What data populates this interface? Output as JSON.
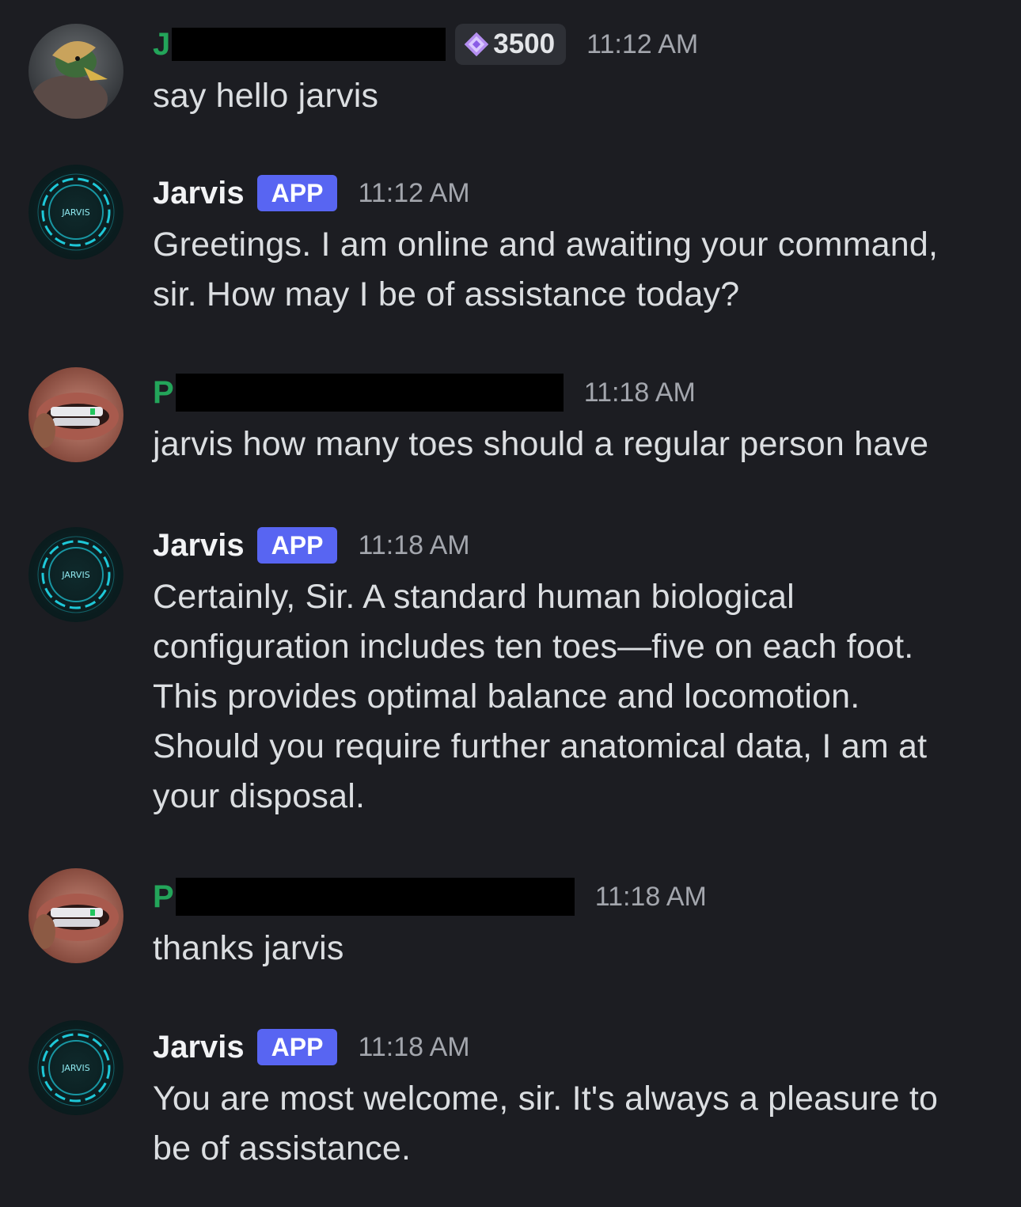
{
  "messages": [
    {
      "author_initial": "J",
      "badge": {
        "icon": "purple-gem-icon",
        "value": "3500"
      },
      "time": "11:12 AM",
      "text": "say hello jarvis"
    },
    {
      "author": "Jarvis",
      "tag": "APP",
      "avatar_label": "JARVIS",
      "time": "11:12 AM",
      "text": "Greetings. I am online and awaiting your command,\nsir. How may I be of assistance today?"
    },
    {
      "author_initial": "P",
      "time": "11:18 AM",
      "text": "jarvis how many toes should a regular person have"
    },
    {
      "author": "Jarvis",
      "tag": "APP",
      "avatar_label": "JARVIS",
      "time": "11:18 AM",
      "text": "Certainly, Sir. A standard human biological\nconfiguration includes ten toes—five on each foot.\nThis provides optimal balance and locomotion.\nShould you require further anatomical data, I am at\nyour disposal."
    },
    {
      "author_initial": "P",
      "time": "11:18 AM",
      "text": "thanks jarvis"
    },
    {
      "author": "Jarvis",
      "tag": "APP",
      "avatar_label": "JARVIS",
      "time": "11:18 AM",
      "text": "You are most welcome, sir. It's always a pleasure to\nbe of assistance."
    }
  ],
  "colors": {
    "background": "#1c1d22",
    "username_green": "#23a55a",
    "app_tag": "#5865f2",
    "jarvis_ring": "#1ec8d8"
  }
}
